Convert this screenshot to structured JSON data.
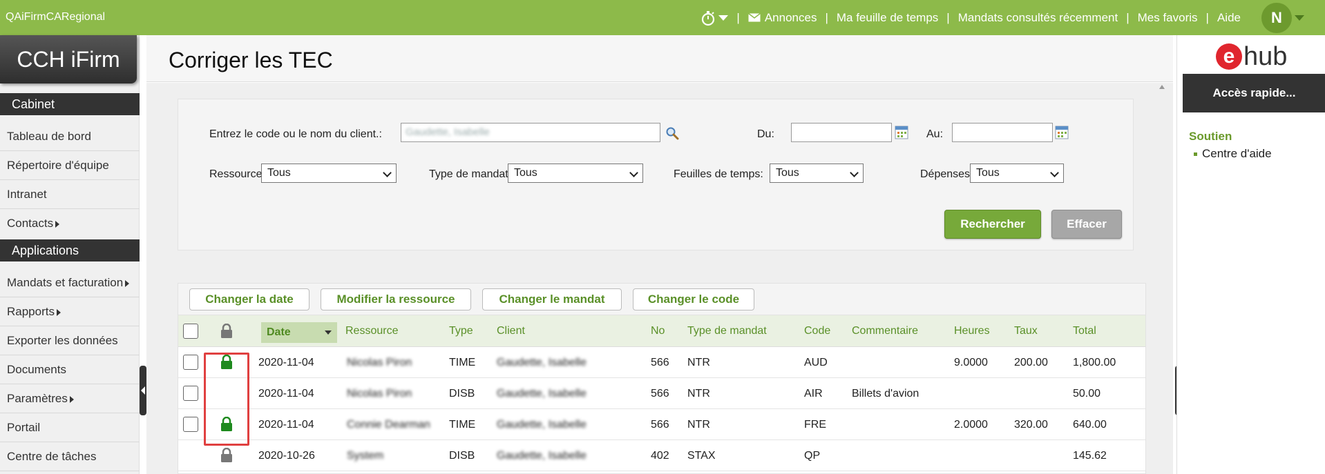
{
  "topbar": {
    "tenant": "QAiFirmCARegional",
    "links": [
      "Annonces",
      "Ma feuille de temps",
      "Mandats consultés récemment",
      "Mes favoris",
      "Aide"
    ],
    "avatar_initial": "N"
  },
  "sidebar": {
    "logo": "CCH iFirm",
    "section_cabinet": "Cabinet",
    "cabinet_items": [
      {
        "label": "Tableau de bord"
      },
      {
        "label": "Répertoire d'équipe"
      },
      {
        "label": "Intranet"
      },
      {
        "label": "Contacts"
      }
    ],
    "section_applications": "Applications",
    "application_items": [
      {
        "label": "Mandats et facturation"
      },
      {
        "label": "Rapports"
      },
      {
        "label": "Exporter les données"
      },
      {
        "label": "Documents"
      },
      {
        "label": "Paramètres"
      },
      {
        "label": "Portail"
      },
      {
        "label": "Centre de tâches"
      }
    ]
  },
  "page": {
    "title": "Corriger les TEC"
  },
  "search": {
    "client_label": "Entrez le code ou le nom du client.:",
    "client_value": "Gaudette, Isabelle",
    "from_label": "Du:",
    "to_label": "Au:",
    "resource_label": "Ressource:",
    "resource_value": "Tous",
    "mandate_type_label": "Type de mandat:",
    "mandate_type_value": "Tous",
    "timesheets_label": "Feuilles de temps:",
    "timesheets_value": "Tous",
    "expenses_label": "Dépenses:",
    "expenses_value": "Tous",
    "search_button": "Rechercher",
    "clear_button": "Effacer"
  },
  "actions": {
    "change_date": "Changer la date",
    "modify_resource": "Modifier la ressource",
    "change_mandate": "Changer le mandat",
    "change_code": "Changer le code"
  },
  "table": {
    "columns": {
      "date": "Date",
      "resource": "Ressource",
      "type": "Type",
      "client": "Client",
      "no": "No",
      "mandate_type": "Type de mandat",
      "code": "Code",
      "comment": "Commentaire",
      "hours": "Heures",
      "rate": "Taux",
      "total": "Total"
    },
    "rows": [
      {
        "date": "2020-11-04",
        "resource": "Nicolas Piron",
        "type": "TIME",
        "client": "Gaudette, Isabelle",
        "no": "566",
        "mandate_type": "NTR",
        "code": "AUD",
        "comment": "",
        "hours": "9.0000",
        "rate": "200.00",
        "total": "1,800.00"
      },
      {
        "date": "2020-11-04",
        "resource": "Nicolas Piron",
        "type": "DISB",
        "client": "Gaudette, Isabelle",
        "no": "566",
        "mandate_type": "NTR",
        "code": "AIR",
        "comment": "Billets d'avion",
        "hours": "",
        "rate": "",
        "total": "50.00"
      },
      {
        "date": "2020-11-04",
        "resource": "Connie Dearman",
        "type": "TIME",
        "client": "Gaudette, Isabelle",
        "no": "566",
        "mandate_type": "NTR",
        "code": "FRE",
        "comment": "",
        "hours": "2.0000",
        "rate": "320.00",
        "total": "640.00"
      },
      {
        "date": "2020-10-26",
        "resource": "System",
        "type": "DISB",
        "client": "Gaudette, Isabelle",
        "no": "402",
        "mandate_type": "STAX",
        "code": "QP",
        "comment": "",
        "hours": "",
        "rate": "",
        "total": "145.62"
      }
    ]
  },
  "right_panel": {
    "logo_e": "e",
    "logo_text": "hub",
    "quick_access": "Accès rapide...",
    "support_title": "Soutien",
    "support_link": "Centre d'aide"
  },
  "colors": {
    "brand_green": "#8dba4a",
    "accent_green": "#5a9028",
    "dark": "#333333",
    "ehub_red": "#e0262e",
    "highlight_red": "#e04040"
  }
}
